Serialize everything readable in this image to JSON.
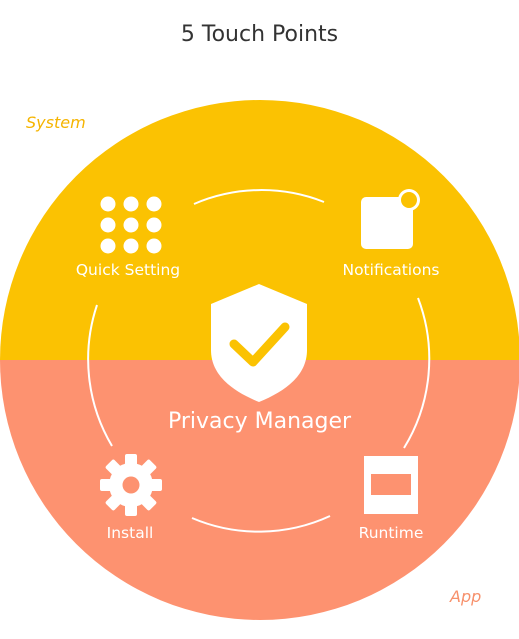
{
  "title": "5 Touch Points",
  "zones": {
    "system": "System",
    "app": "App"
  },
  "center": {
    "label": "Privacy Manager",
    "icon": "shield-check-icon"
  },
  "nodes": [
    {
      "label": "Quick Setting",
      "icon": "grid-dots-icon"
    },
    {
      "label": "Notifications",
      "icon": "notification-badge-icon"
    },
    {
      "label": "Install",
      "icon": "gear-icon"
    },
    {
      "label": "Runtime",
      "icon": "app-window-icon"
    }
  ],
  "colors": {
    "system": "#fbc202",
    "app": "#fd9270",
    "zone_system_text": "#f5b400",
    "zone_app_text": "#f7916c",
    "foreground": "#ffffff"
  }
}
